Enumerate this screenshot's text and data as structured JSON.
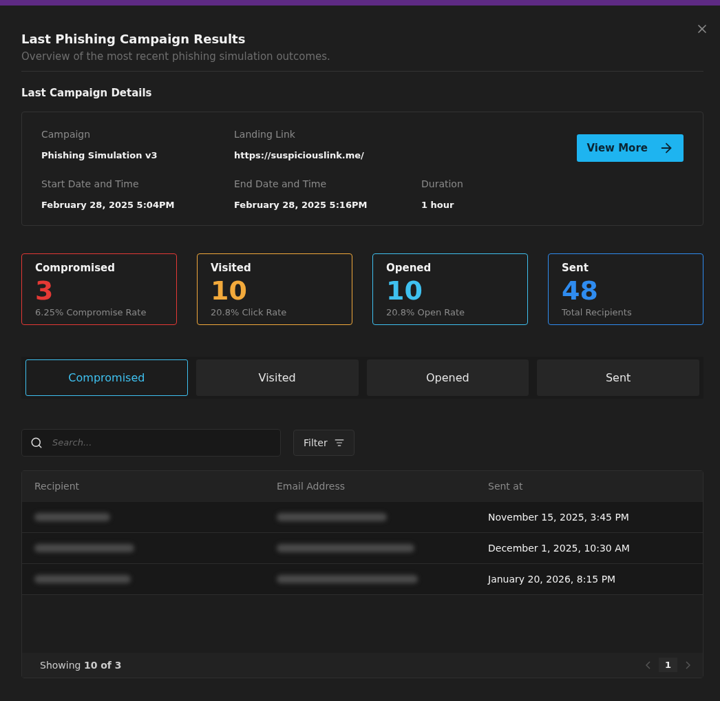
{
  "dialog": {
    "title": "Last Phishing Campaign Results",
    "subtitle": "Overview of the most recent phishing simulation outcomes."
  },
  "details": {
    "heading": "Last Campaign Details",
    "button": "View More",
    "field_rows": [
      [
        {
          "label": "Campaign",
          "value": "Phishing Simulation v3"
        },
        {
          "label": "Landing Link",
          "value": "https://suspiciouslink.me/"
        }
      ],
      [
        {
          "label": "Start Date and Time",
          "value": "February 28, 2025 5:04PM"
        },
        {
          "label": "End Date and Time",
          "value": "February 28, 2025 5:16PM"
        },
        {
          "label": "Duration",
          "value": "1 hour"
        }
      ]
    ]
  },
  "stats": [
    {
      "title": "Compromised",
      "count": "3",
      "caption": "6.25% Compromise Rate",
      "color": "#e53935"
    },
    {
      "title": "Visited",
      "count": "10",
      "caption": "20.8% Click Rate",
      "color": "#f2a93b"
    },
    {
      "title": "Opened",
      "count": "10",
      "caption": "20.8% Open Rate",
      "color": "#3fc1f0"
    },
    {
      "title": "Sent",
      "count": "48",
      "caption": "Total Recipients",
      "color": "#2f8cf0"
    }
  ],
  "tabs": [
    {
      "label": "Compromised",
      "selected": true
    },
    {
      "label": "Visited",
      "selected": false
    },
    {
      "label": "Opened",
      "selected": false
    },
    {
      "label": "Sent",
      "selected": false
    }
  ],
  "search": {
    "placeholder": "Search..."
  },
  "filter": "Filter",
  "table": {
    "columns": [
      "Recipient",
      "Email Address",
      "Sent at"
    ],
    "rows": [
      {
        "recipient_blurred": true,
        "email_blurred": true,
        "sent_at": "November 15, 2025, 3:45 PM"
      },
      {
        "recipient_blurred": true,
        "email_blurred": true,
        "sent_at": "December 1, 2025, 10:30 AM"
      },
      {
        "recipient_blurred": true,
        "email_blurred": true,
        "sent_at": "January 20, 2026, 8:15 PM"
      }
    ]
  },
  "footer": {
    "showing": "Showing",
    "count": "10 of 3",
    "page": "1"
  }
}
